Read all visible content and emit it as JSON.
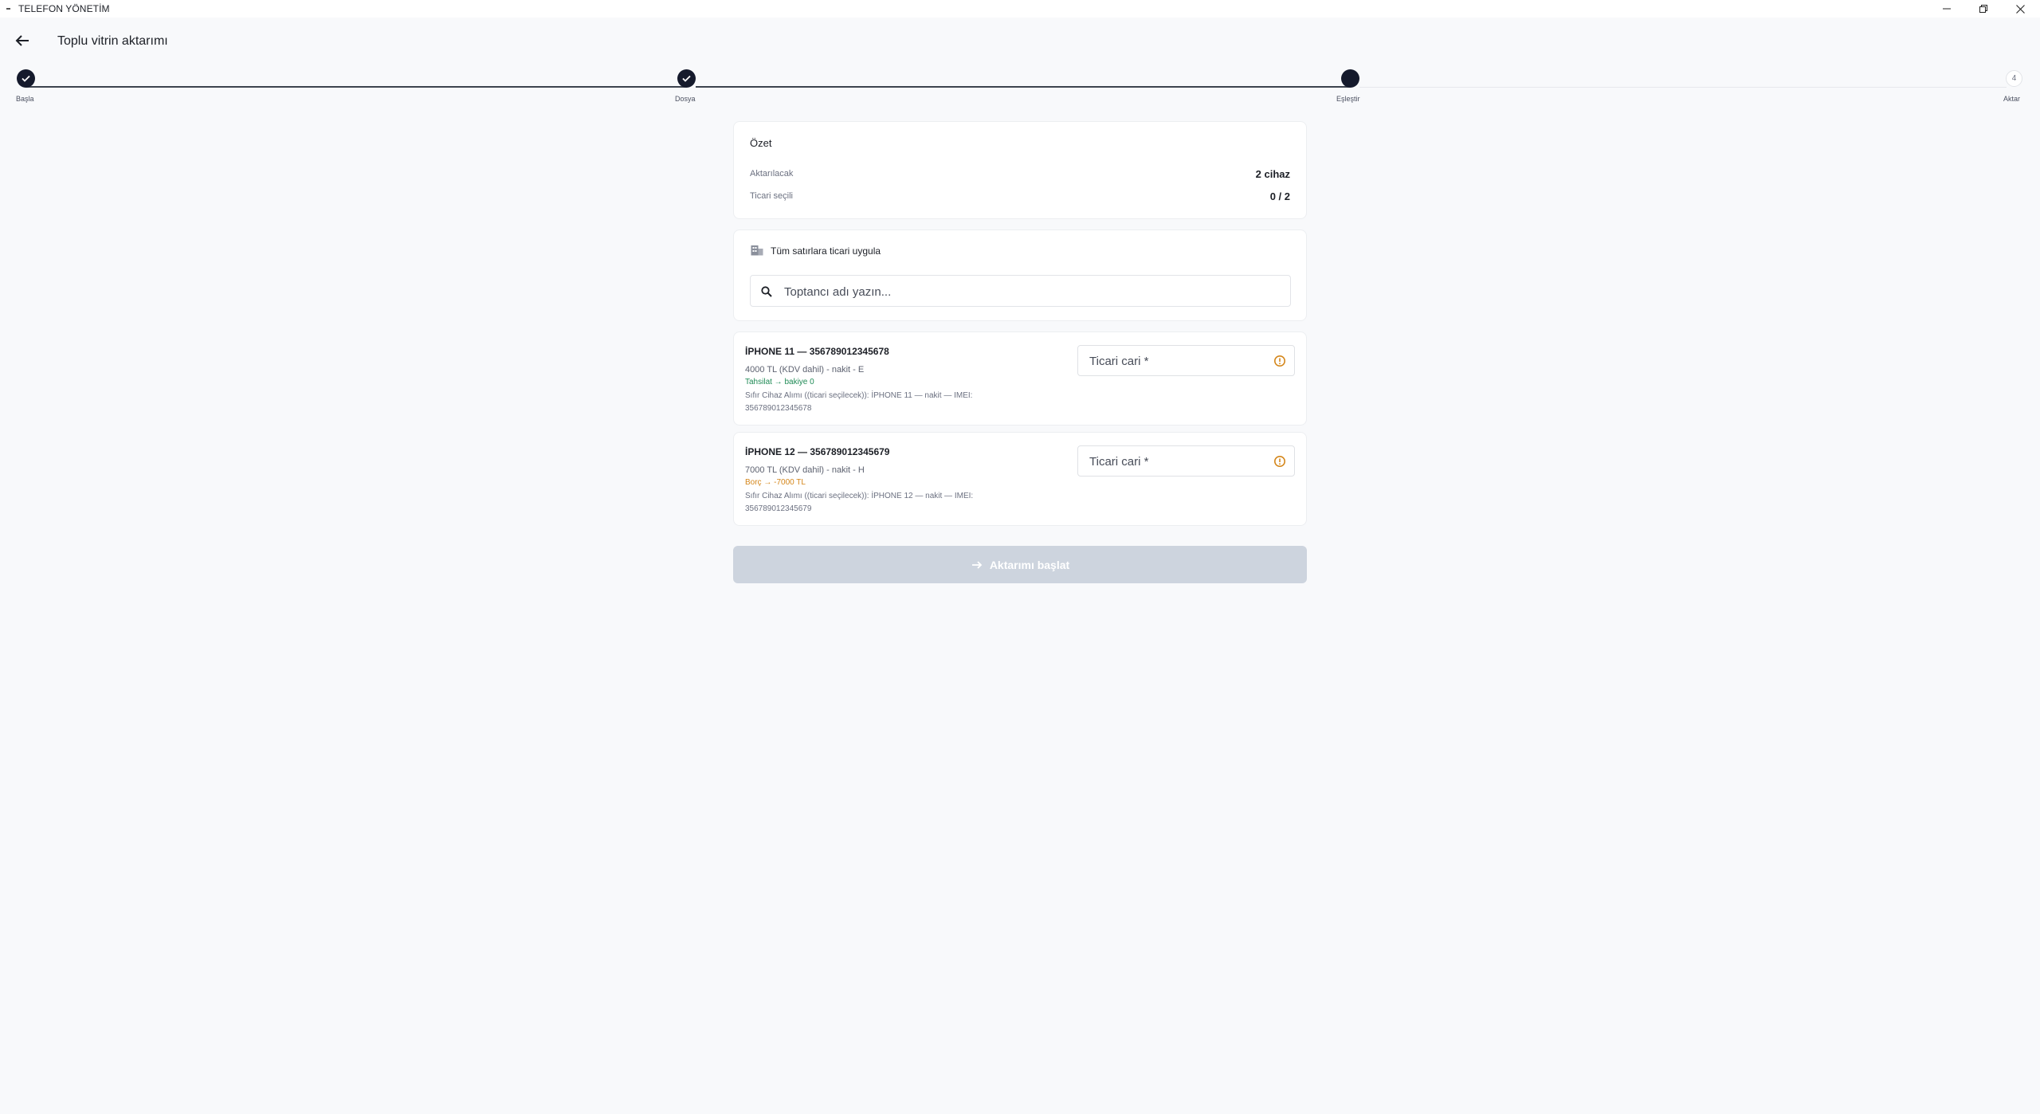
{
  "window": {
    "title": "TELEFON YÖNETİM"
  },
  "header": {
    "title": "Toplu vitrin aktarımı"
  },
  "stepper": {
    "steps": [
      {
        "label": "Başla",
        "state": "done"
      },
      {
        "label": "Dosya",
        "state": "done"
      },
      {
        "label": "Eşleştir",
        "state": "active"
      },
      {
        "label": "Aktar",
        "state": "pending",
        "number": "4"
      }
    ]
  },
  "summary": {
    "title": "Özet",
    "rows": [
      {
        "label": "Aktarılacak",
        "value": "2 cihaz"
      },
      {
        "label": "Ticari seçili",
        "value": "0 / 2"
      }
    ]
  },
  "apply_all": {
    "label": "Tüm satırlara ticari uygula",
    "placeholder": "Toptancı adı yazın..."
  },
  "items": [
    {
      "title": "İPHONE 11 — 356789012345678",
      "price": "4000 TL (KDV dahil) - nakit - E",
      "status": "Tahsilat → bakiye 0",
      "status_color": "#1f8a55",
      "desc_line1": "Sıfır Cihaz Alımı ((ticari seçilecek)): İPHONE 11 — nakit — IMEI:",
      "desc_line2": "356789012345678",
      "field_placeholder": "Ticari cari *"
    },
    {
      "title": "İPHONE 12 — 356789012345679",
      "price": "7000 TL (KDV dahil) - nakit - H",
      "status": "Borç → -7000 TL",
      "status_color": "#d4861a",
      "desc_line1": "Sıfır Cihaz Alımı ((ticari seçilecek)): İPHONE 12 — nakit — IMEI:",
      "desc_line2": "356789012345679",
      "field_placeholder": "Ticari cari *"
    }
  ],
  "actions": {
    "start_label": "Aktarımı başlat",
    "start_enabled": false
  },
  "colors": {
    "accent_dark": "#151a2c",
    "warning": "#d4861a",
    "success": "#1f8a55",
    "disabled_button": "#cdd4de"
  }
}
